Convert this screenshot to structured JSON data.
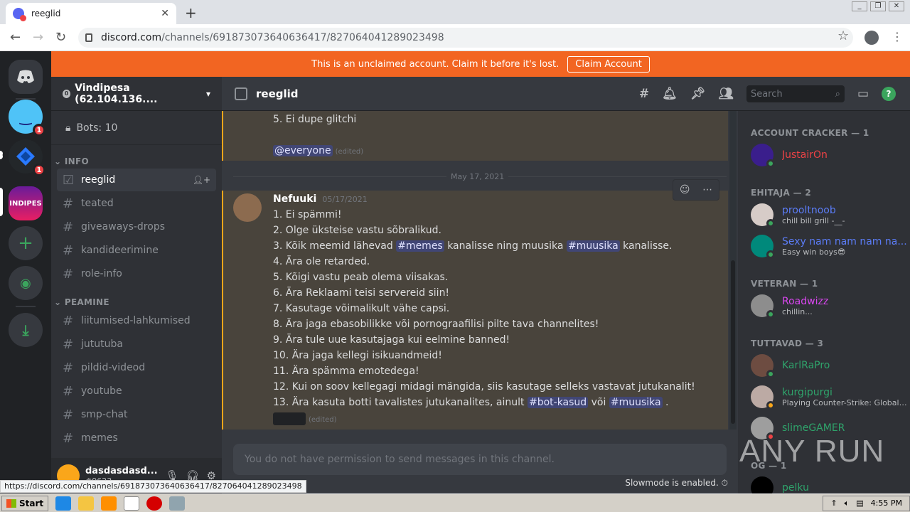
{
  "browser": {
    "tab_title": "reeglid",
    "tab_close": "✕",
    "new_tab": "+",
    "url_host": "discord.com",
    "url_path": "/channels/691873073640636417/827064041289023498",
    "status_url": "https://discord.com/channels/691873073640636417/827064041289023498"
  },
  "banner": {
    "text": "This is an unclaimed account. Claim it before it's lost.",
    "button": "Claim Account"
  },
  "guilds": [
    {
      "label": "",
      "badge": ""
    },
    {
      "label": "",
      "badge": "1"
    },
    {
      "label": "",
      "badge": "1"
    },
    {
      "label": "INDIPES",
      "badge": ""
    }
  ],
  "server": {
    "name": "Vindipesa (62.104.136....",
    "zero": "0",
    "bots": "Bots: 10"
  },
  "categories": [
    {
      "name": "INFO",
      "channels": [
        "reeglid",
        "teated",
        "giveaways-drops",
        "kandideerimine",
        "role-info"
      ]
    },
    {
      "name": "PEAMINE",
      "channels": [
        "liitumised-lahkumised",
        "jututuba",
        "pildid-videod",
        "youtube",
        "smp-chat",
        "memes"
      ]
    }
  ],
  "user": {
    "name": "dasdasdasd...",
    "tag": "#9623"
  },
  "channel_header": {
    "name": "reeglid",
    "search_placeholder": "Search"
  },
  "messages": {
    "prev_line": "5. Ei dupe glitchi",
    "prev_mention": "@everyone",
    "edited": "(edited)",
    "date_divider": "May 17, 2021",
    "author": "Nefuuki",
    "timestamp": "05/17/2021",
    "lines": [
      "1. Ei spämmi!",
      "2. Olge üksteise vastu sõbralikud.",
      "4. Ära ole retarded.",
      "5. Kõigi vastu peab olema viisakas.",
      "6. Ära Reklaami teisi servereid siin!",
      "7. Kasutage võimalikult vähe capsi.",
      "8. Ära jaga ebasobilikke või pornograafilisi pilte tava channelites!",
      "9. Ära tule uue kasutajaga kui eelmine banned!",
      "10. Ära jaga kellegi isikuandmeid!",
      "11. Ära spämma emotedega!",
      "12. Kui on soov kellegagi midagi mängida, siis kasutage selleks vastavat jutukanalit!"
    ],
    "line3_a": "3. Kõik meemid lähevad",
    "line3_m1": "#memes",
    "line3_b": "kanalisse ning muusika",
    "line3_m2": "#muusika",
    "line3_c": "kanalisse.",
    "line13_a": "13. Ära kasuta botti tavalistes jutukanalites, ainult",
    "line13_m1": "#bot-kasud",
    "line13_b": "või",
    "line13_m2": "#muusika",
    "line13_c": "."
  },
  "input": {
    "placeholder": "You do not have permission to send messages in this channel.",
    "slowmode": "Slowmode is enabled."
  },
  "member_groups": [
    {
      "title": "ACCOUNT CRACKER — 1",
      "members": [
        {
          "name": "JustairOn",
          "status": "",
          "color": "#ed4245"
        }
      ]
    },
    {
      "title": "EHITAJA — 2",
      "members": [
        {
          "name": "prooltnoob",
          "status": "chill bill grill -__-",
          "color": "#5b7cf6"
        },
        {
          "name": "Sexy nam nam nam na...",
          "status": "Easy win boys😎",
          "color": "#5b7cf6"
        }
      ]
    },
    {
      "title": "VETERAN — 1",
      "members": [
        {
          "name": "Roadwizz",
          "status": "chillin...",
          "color": "#d946ef"
        }
      ]
    },
    {
      "title": "TUTTAVAD — 3",
      "members": [
        {
          "name": "KarlRaPro",
          "status": "",
          "color": "#2fa36b"
        },
        {
          "name": "kurgipurgi",
          "status": "Playing Counter-Strike: Global ...",
          "color": "#2fa36b"
        },
        {
          "name": "slimeGAMER",
          "status": "",
          "color": "#2fa36b"
        }
      ]
    },
    {
      "title": "OG — 1",
      "members": [
        {
          "name": "pelku",
          "status": "",
          "color": "#2fa36b"
        }
      ]
    }
  ],
  "watermark": "ANY RUN",
  "taskbar": {
    "start": "Start",
    "time": "4:55 PM"
  }
}
